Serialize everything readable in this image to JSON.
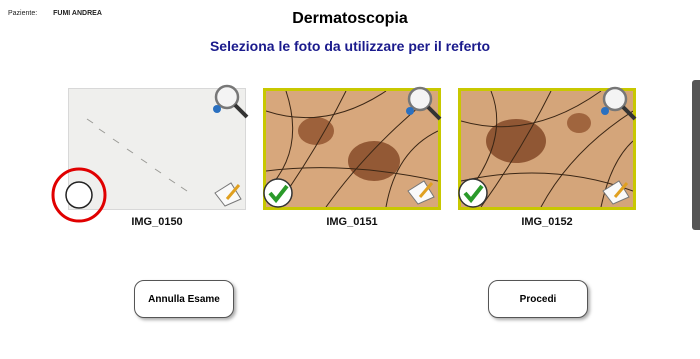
{
  "patient": {
    "label": "Paziente:",
    "name": "FUMI ANDREA"
  },
  "header": {
    "title": "Dermatoscopia",
    "subtitle": "Seleziona le foto da utilizzare per il referto"
  },
  "photos": [
    {
      "name": "IMG_0150",
      "selected": false
    },
    {
      "name": "IMG_0151",
      "selected": true
    },
    {
      "name": "IMG_0152",
      "selected": true
    }
  ],
  "buttons": {
    "cancel": "Annulla Esame",
    "proceed": "Procedi"
  },
  "colors": {
    "subtitle": "#1a1a8c",
    "selection_border": "#c8c800",
    "highlight_ring": "#e00000"
  },
  "icons": [
    "zoom-magnifier-icon",
    "note-pencil-icon",
    "checkmark-icon",
    "radio-circle-icon"
  ]
}
